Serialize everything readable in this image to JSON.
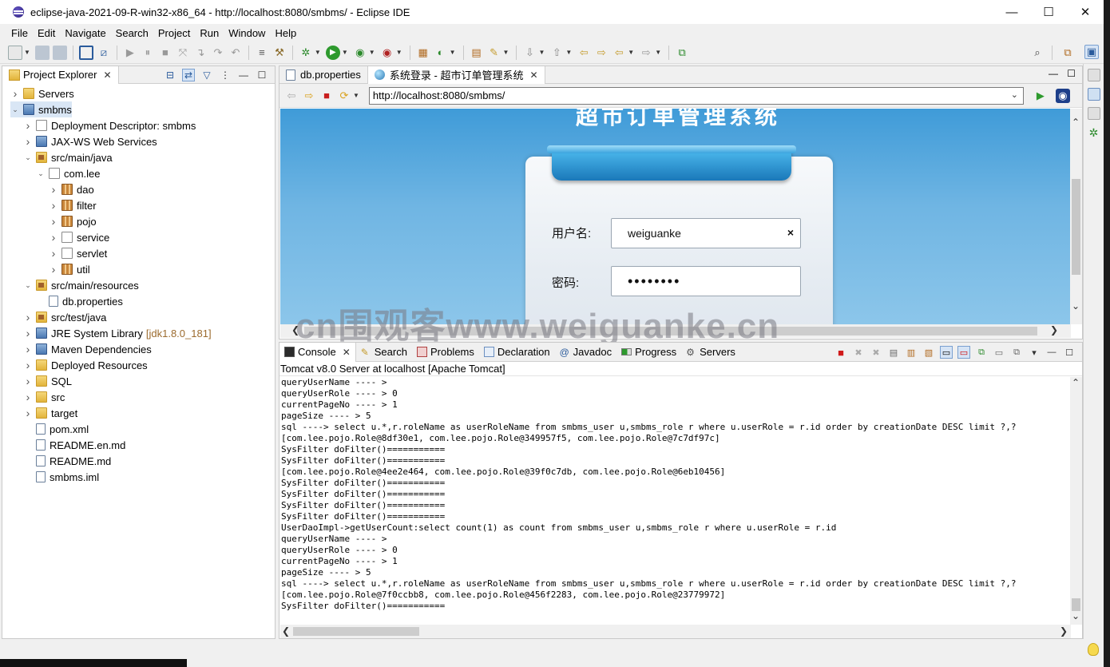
{
  "window": {
    "title": "eclipse-java-2021-09-R-win32-x86_64 - http://localhost:8080/smbms/ - Eclipse IDE",
    "minimize": "—",
    "maximize": "☐",
    "close": "✕"
  },
  "menu": [
    "File",
    "Edit",
    "Navigate",
    "Search",
    "Project",
    "Run",
    "Window",
    "Help"
  ],
  "project_explorer": {
    "tab_label": "Project Explorer",
    "tree": [
      {
        "label": "Servers",
        "depth": 0,
        "expanded": false,
        "icon": "folder"
      },
      {
        "label": "smbms",
        "depth": 0,
        "expanded": true,
        "icon": "project",
        "selected": true
      },
      {
        "label": "Deployment Descriptor: smbms",
        "depth": 1,
        "expanded": false,
        "icon": "descriptor"
      },
      {
        "label": "JAX-WS Web Services",
        "depth": 1,
        "expanded": false,
        "icon": "webservice"
      },
      {
        "label": "src/main/java",
        "depth": 1,
        "expanded": true,
        "icon": "source-folder"
      },
      {
        "label": "com.lee",
        "depth": 2,
        "expanded": true,
        "icon": "package-empty"
      },
      {
        "label": "dao",
        "depth": 3,
        "expanded": false,
        "icon": "package"
      },
      {
        "label": "filter",
        "depth": 3,
        "expanded": false,
        "icon": "package"
      },
      {
        "label": "pojo",
        "depth": 3,
        "expanded": false,
        "icon": "package"
      },
      {
        "label": "service",
        "depth": 3,
        "expanded": false,
        "icon": "package-empty"
      },
      {
        "label": "servlet",
        "depth": 3,
        "expanded": false,
        "icon": "package-empty"
      },
      {
        "label": "util",
        "depth": 3,
        "expanded": false,
        "icon": "package"
      },
      {
        "label": "src/main/resources",
        "depth": 1,
        "expanded": true,
        "icon": "source-folder"
      },
      {
        "label": "db.properties",
        "depth": 2,
        "expanded": null,
        "icon": "file"
      },
      {
        "label": "src/test/java",
        "depth": 1,
        "expanded": false,
        "icon": "source-folder"
      },
      {
        "label": "JRE System Library",
        "suffix": "[jdk1.8.0_181]",
        "depth": 1,
        "expanded": false,
        "icon": "library"
      },
      {
        "label": "Maven Dependencies",
        "depth": 1,
        "expanded": false,
        "icon": "library"
      },
      {
        "label": "Deployed Resources",
        "depth": 1,
        "expanded": false,
        "icon": "deployed"
      },
      {
        "label": "SQL",
        "depth": 1,
        "expanded": false,
        "icon": "folder"
      },
      {
        "label": "src",
        "depth": 1,
        "expanded": false,
        "icon": "folder"
      },
      {
        "label": "target",
        "depth": 1,
        "expanded": false,
        "icon": "folder"
      },
      {
        "label": "pom.xml",
        "depth": 1,
        "expanded": null,
        "icon": "xml-file"
      },
      {
        "label": "README.en.md",
        "depth": 1,
        "expanded": null,
        "icon": "word-file"
      },
      {
        "label": "README.md",
        "depth": 1,
        "expanded": null,
        "icon": "word-file"
      },
      {
        "label": "smbms.iml",
        "depth": 1,
        "expanded": null,
        "icon": "file"
      }
    ]
  },
  "editor": {
    "tabs": [
      {
        "label": "db.properties",
        "active": false
      },
      {
        "label": "系统登录 - 超市订单管理系统",
        "active": true
      }
    ],
    "url": "http://localhost:8080/smbms/",
    "page": {
      "title": "超市订单管理系统",
      "username_label": "用户名:",
      "username_value": "weiguanke",
      "clear_glyph": "×",
      "password_label": "密码:",
      "password_value": "••••••••"
    }
  },
  "watermark": "cn围观客www.weiguanke.cn",
  "console": {
    "tabs": [
      "Console",
      "Search",
      "Problems",
      "Declaration",
      "Javadoc",
      "Progress",
      "Servers"
    ],
    "description": "Tomcat v8.0 Server at localhost [Apache Tomcat]",
    "lines": [
      "queryUserName ---- > ",
      "queryUserRole ---- > 0",
      "currentPageNo ---- > 1",
      "pageSize ---- > 5",
      "sql ----> select u.*,r.roleName as userRoleName from smbms_user u,smbms_role r where u.userRole = r.id order by creationDate DESC limit ?,?",
      "[com.lee.pojo.Role@8df30e1, com.lee.pojo.Role@349957f5, com.lee.pojo.Role@7c7df97c]",
      "SysFilter doFilter()===========",
      "SysFilter doFilter()===========",
      "[com.lee.pojo.Role@4ee2e464, com.lee.pojo.Role@39f0c7db, com.lee.pojo.Role@6eb10456]",
      "SysFilter doFilter()===========",
      "SysFilter doFilter()===========",
      "SysFilter doFilter()===========",
      "SysFilter doFilter()===========",
      "UserDaoImpl->getUserCount:select count(1) as count from smbms_user u,smbms_role r where u.userRole = r.id",
      "queryUserName ---- > ",
      "queryUserRole ---- > 0",
      "currentPageNo ---- > 1",
      "pageSize ---- > 5",
      "sql ----> select u.*,r.roleName as userRoleName from smbms_user u,smbms_role r where u.userRole = r.id order by creationDate DESC limit ?,?",
      "[com.lee.pojo.Role@7f0ccbb8, com.lee.pojo.Role@456f2283, com.lee.pojo.Role@23779972]",
      "SysFilter doFilter()==========="
    ]
  }
}
